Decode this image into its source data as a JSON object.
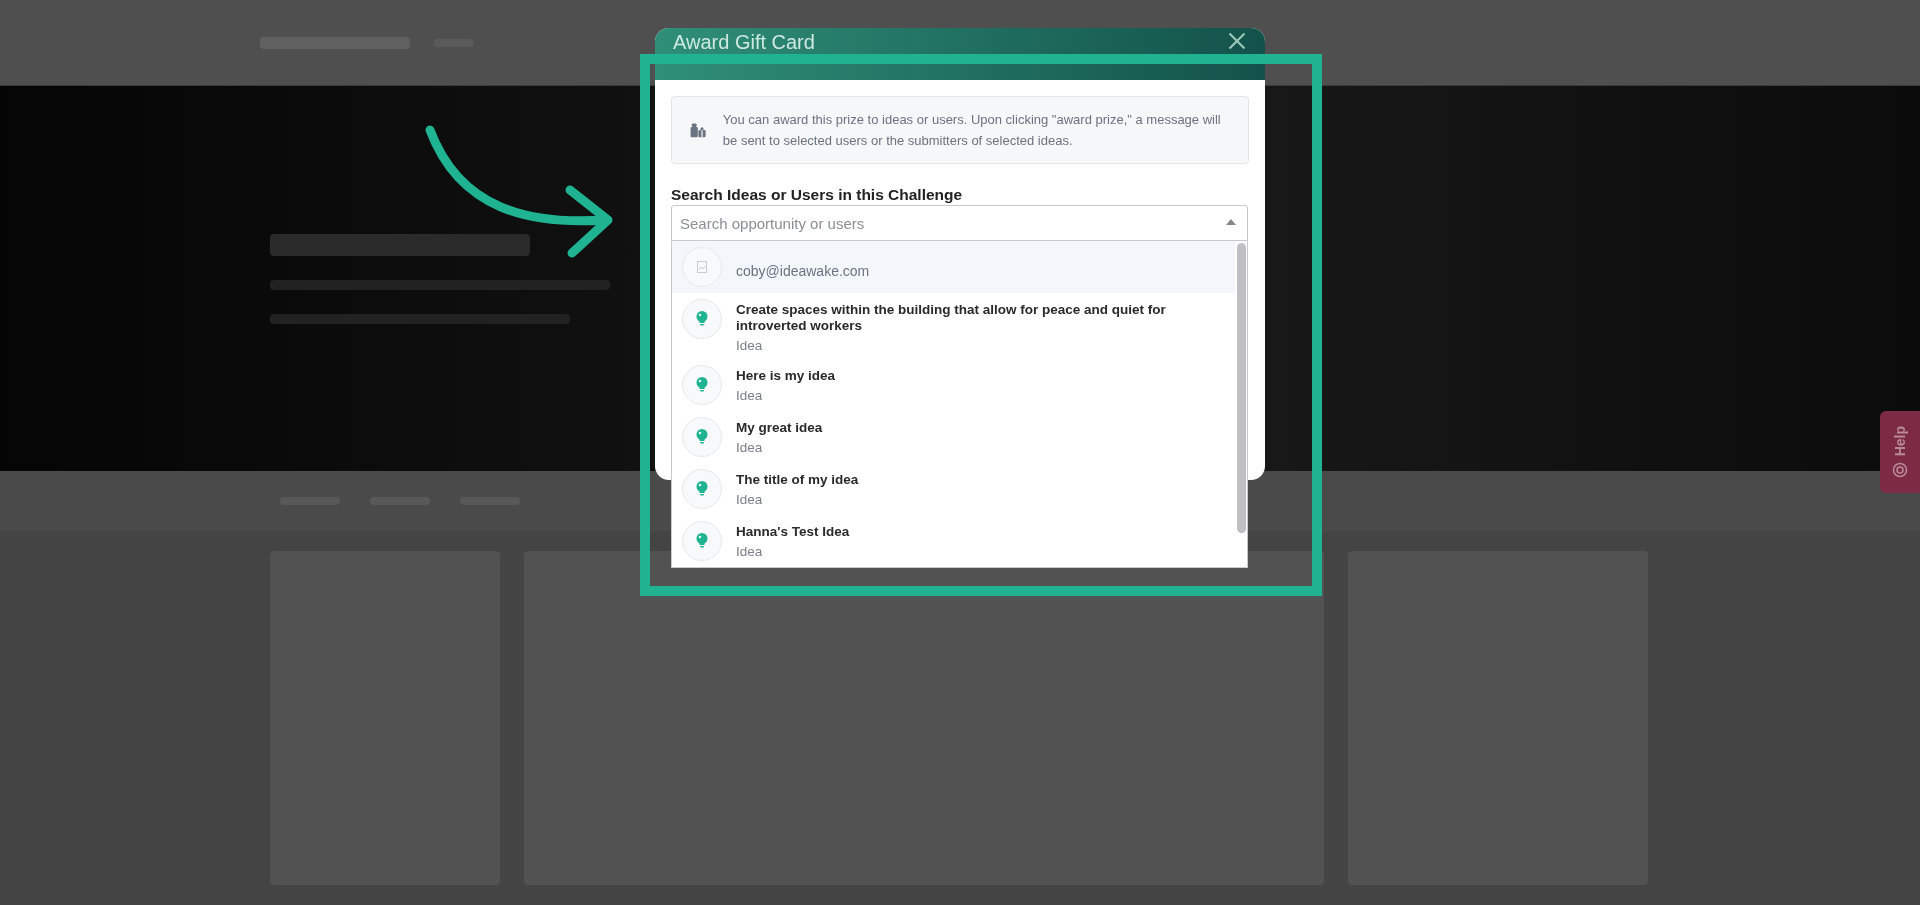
{
  "dialog": {
    "title": "Award Gift Card",
    "info": "You can award this prize to ideas or users. Upon clicking \"award prize,\" a message will be sent to selected users or the submitters of selected ideas.",
    "search_label": "Search Ideas or Users in this Challenge",
    "search": {
      "placeholder": "Search opportunity or users",
      "expanded": true
    },
    "results": [
      {
        "kind": "user",
        "title": "coby@ideawake.com",
        "selected": true
      },
      {
        "kind": "idea",
        "title": "Create spaces within the building that allow for peace and quiet for introverted workers",
        "type": "Idea",
        "selected": false
      },
      {
        "kind": "idea",
        "title": "Here is my idea",
        "type": "Idea",
        "selected": false
      },
      {
        "kind": "idea",
        "title": "My great idea",
        "type": "Idea",
        "selected": false
      },
      {
        "kind": "idea",
        "title": "The title of my idea",
        "type": "Idea",
        "selected": false
      },
      {
        "kind": "idea",
        "title": "Hanna's Test Idea",
        "type": "Idea",
        "selected": false
      }
    ]
  },
  "help_tab": {
    "label": "Help"
  }
}
